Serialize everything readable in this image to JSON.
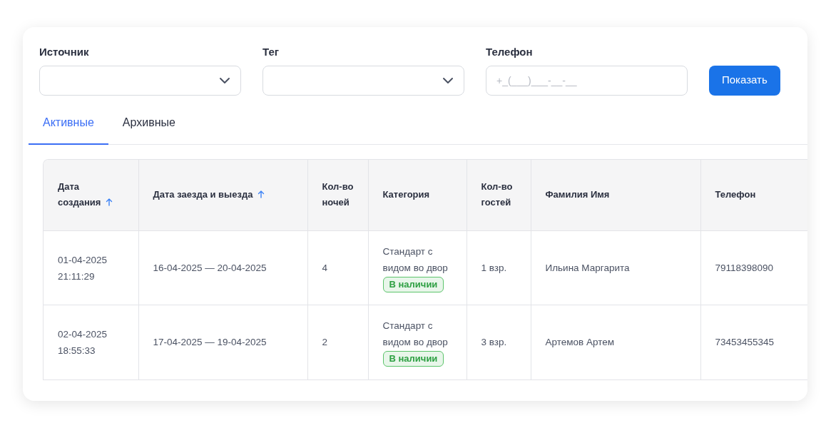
{
  "filters": [
    {
      "label": "Источник",
      "kind": "select"
    },
    {
      "label": "Тег",
      "kind": "select"
    },
    {
      "label": "Телефон",
      "kind": "input",
      "placeholder": "+_(___)___-__-__"
    }
  ],
  "show_button": "Показать",
  "tabs": [
    {
      "label": "Активные",
      "selected": true
    },
    {
      "label": "Архивные",
      "selected": false
    }
  ],
  "table": {
    "columns": [
      {
        "label": "Дата создания",
        "sorted_ascending": true
      },
      {
        "label": "Дата заезда и выезда",
        "sorted_ascending": true
      },
      {
        "label": "Кол-во ночей"
      },
      {
        "label": "Категория"
      },
      {
        "label": "Кол-во гостей"
      },
      {
        "label": "Фамилия Имя"
      },
      {
        "label": "Телефон"
      }
    ],
    "rows": [
      {
        "created": "01-04-2025 21:11:29",
        "dates": "16-04-2025 — 20-04-2025",
        "nights": "4",
        "category": "Стандарт с видом во двор",
        "availability": "В наличии",
        "guests": "1 взр.",
        "name": "Ильина Маргарита",
        "phone": "79118398090"
      },
      {
        "created": "02-04-2025 18:55:33",
        "dates": "17-04-2025 — 19-04-2025",
        "nights": "2",
        "category": "Стандарт с видом во двор",
        "availability": "В наличии",
        "guests": "3 взр.",
        "name": "Артемов Артем",
        "phone": "73453455345"
      }
    ]
  }
}
